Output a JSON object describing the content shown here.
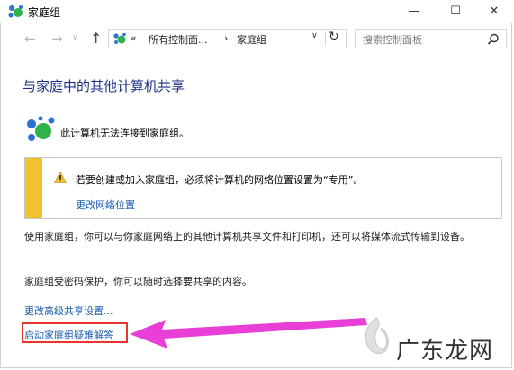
{
  "window": {
    "title": "家庭组"
  },
  "titlebar": {
    "minimize": "—",
    "maximize": "☐",
    "close": "✕"
  },
  "nav": {
    "back": "←",
    "forward": "→",
    "recent": "∨",
    "up": "↑",
    "address": {
      "overflow": "«",
      "crumbs": [
        "所有控制面...",
        "家庭组"
      ],
      "separator": "›",
      "dropdown": "∨",
      "refresh": "↻"
    },
    "search": {
      "placeholder": "搜索控制面板",
      "icon": "search-icon"
    }
  },
  "main": {
    "title": "与家庭中的其他计算机共享",
    "status_text": "此计算机无法连接到家庭组。",
    "notice": {
      "text": "若要创建或加入家庭组，必须将计算机的网络位置设置为“专用”。",
      "link": "更改网络位置"
    },
    "para1": "使用家庭组，你可以与你家庭网络上的其他计算机共享文件和打印机，还可以将媒体流式传输到设备。",
    "para2": "家庭组受密码保护，你可以随时选择要共享的内容。",
    "links": [
      "更改高级共享设置...",
      "启动家庭组疑难解答"
    ]
  },
  "annotation": {
    "box_color": "#e8352c",
    "arrow_color": "#e83fd6"
  },
  "watermark": {
    "text": "广东龙网"
  },
  "colors": {
    "title": "#1e3287",
    "link": "#1a5db0",
    "warning_bar": "#f2c12e",
    "homegroup_green": "#2db34a",
    "homegroup_blue": "#2a73d0"
  }
}
